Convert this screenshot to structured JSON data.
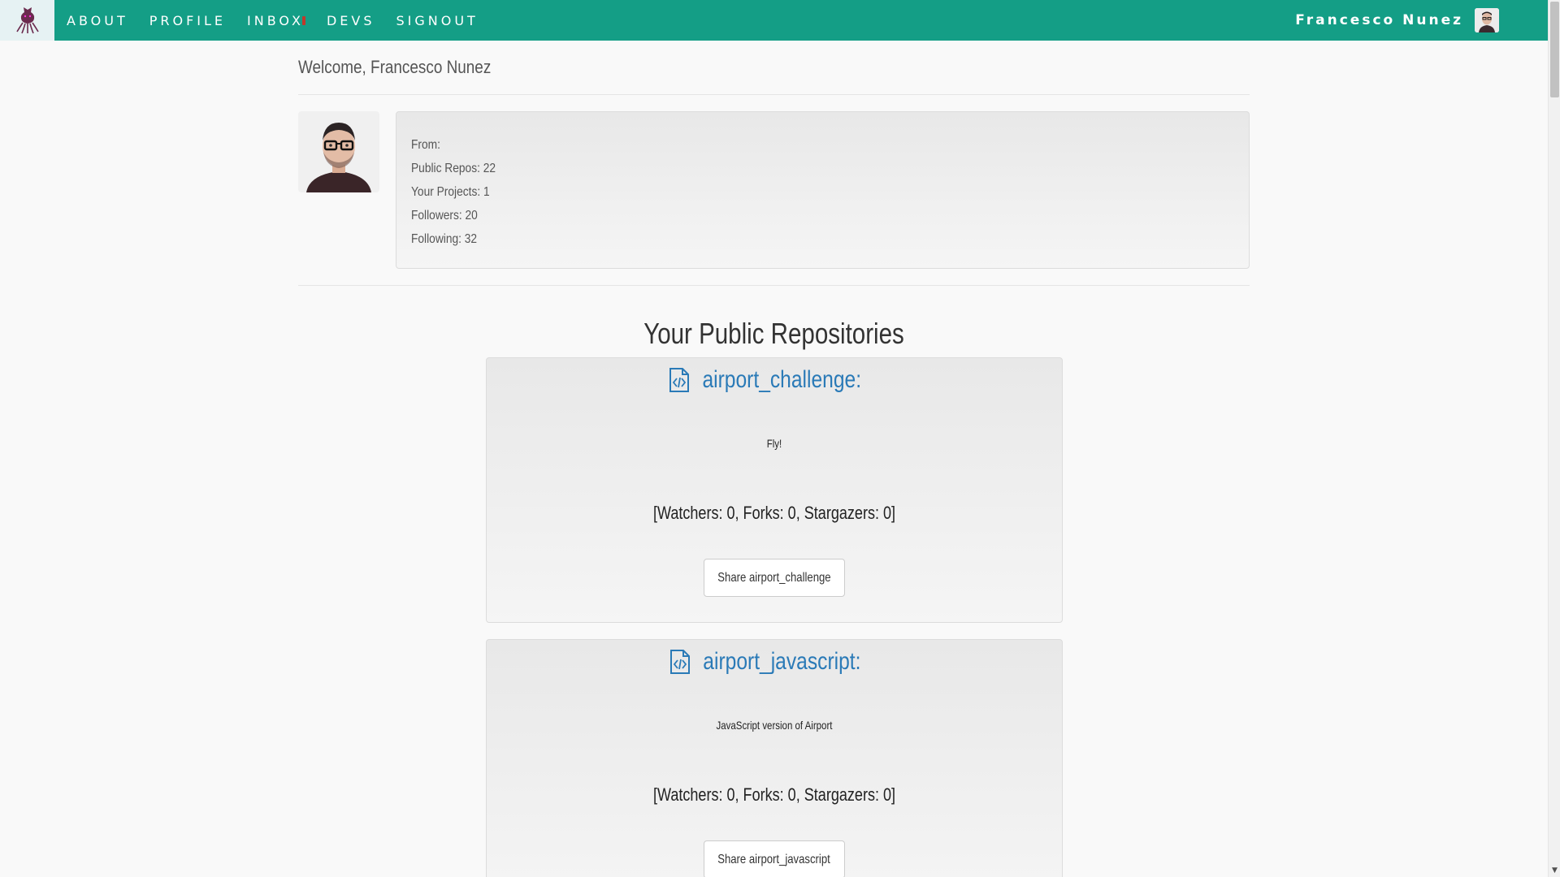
{
  "nav": {
    "logo_icon": "octocat-logo-icon",
    "links": [
      "ABOUT",
      "PROFILE",
      "INBOX",
      "DEVS",
      "SIGNOUT"
    ],
    "user_name": "Francesco Nunez",
    "colors": {
      "bar": "#149e86",
      "logo_bg": "#e6f2f3",
      "inbox_dot": "#c0392b"
    }
  },
  "welcome": "Welcome, Francesco Nunez",
  "profile": {
    "stats": [
      "From:",
      "Public Repos: 22",
      "Your Projects: 1",
      "Followers: 20",
      "Following: 32"
    ]
  },
  "repos_title": "Your Public Repositories",
  "repos": [
    {
      "name": "airport_challenge:",
      "description": "Fly!",
      "counts": "[Watchers: 0, Forks: 0, Stargazers: 0]",
      "share_label": "Share airport_challenge"
    },
    {
      "name": "airport_javascript:",
      "description": "JavaScript version of Airport",
      "counts": "[Watchers: 0, Forks: 0, Stargazers: 0]",
      "share_label": "Share airport_javascript"
    }
  ],
  "accent_color": "#2a7ab7"
}
